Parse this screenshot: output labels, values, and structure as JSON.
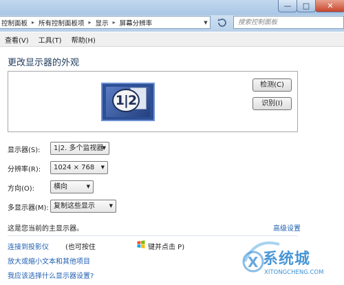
{
  "window": {
    "minimize_glyph": "—",
    "maximize_glyph": "□",
    "close_glyph": "✕"
  },
  "address": {
    "crumbs": [
      "控制面板",
      "所有控制面板项",
      "显示",
      "屏幕分辨率"
    ],
    "search_placeholder": "搜索控制面板"
  },
  "menu": [
    "查看(V)",
    "工具(T)",
    "帮助(H)"
  ],
  "page_title": "更改显示器的外观",
  "preview": {
    "monitor_label": "1|2",
    "detect_button": "检测(C)",
    "identify_button": "识别(I)"
  },
  "settings": {
    "display_label": "显示器(S):",
    "display_value": "1|2. 多个监视器",
    "resolution_label": "分辨率(R):",
    "resolution_value": "1024 × 768",
    "orientation_label": "方向(O):",
    "orientation_value": "横向",
    "multi_label": "多显示器(M):",
    "multi_value": "复制这些显示"
  },
  "primary_note": "这是您当前的主显示器。",
  "advanced_link": "高级设置",
  "links": {
    "projector": "连接到投影仪",
    "projector_rest": "(也可按住",
    "projector_key": "键并点击 P)",
    "enlarge": "放大或缩小文本和其他项目",
    "which": "我应该选择什么显示器设置?"
  },
  "watermark": {
    "text": "系统城",
    "url": "XITONGCHENG.COM"
  },
  "icons": {
    "refresh": "refresh-icon",
    "windows": "windows-logo-icon",
    "dropdown": "chevron-down-icon"
  }
}
